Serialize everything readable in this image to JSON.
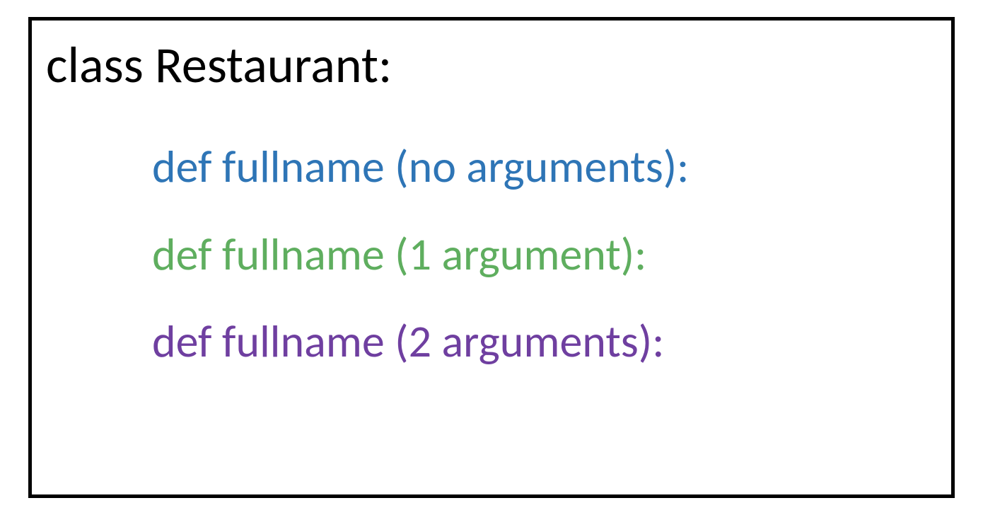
{
  "class_header": "class Restaurant:",
  "methods": {
    "line1": "def fullname (no arguments):",
    "line2": "def fullname (1 argument):",
    "line3": "def fullname (2 arguments):"
  },
  "colors": {
    "border": "#000000",
    "text_default": "#000000",
    "method1": "#2e75b6",
    "method2": "#5fae5f",
    "method3": "#6f3fa0"
  }
}
